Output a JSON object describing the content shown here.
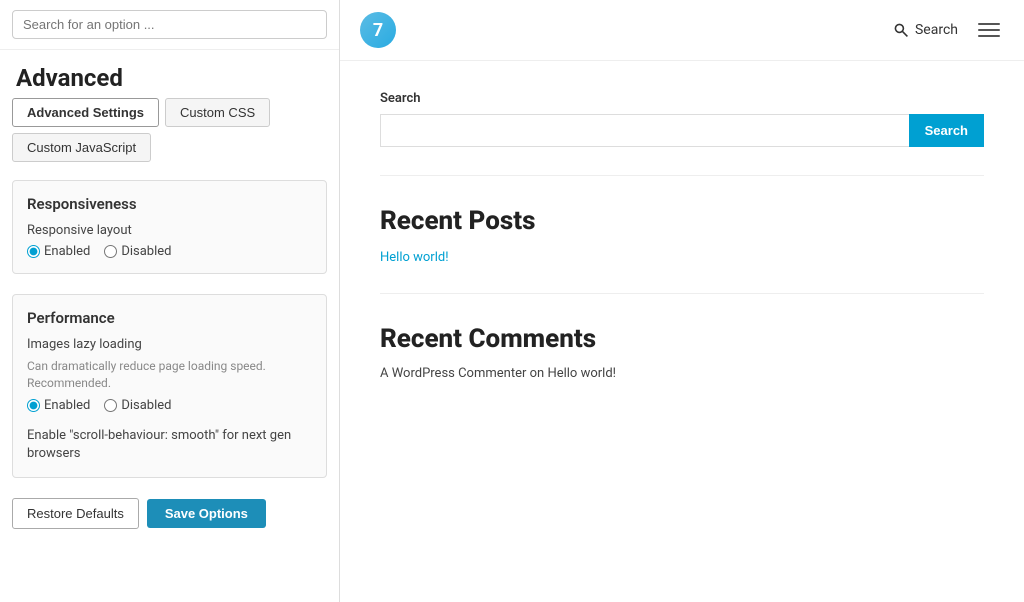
{
  "left": {
    "search_placeholder": "Search for an option ...",
    "heading": "Advanced",
    "tabs": [
      {
        "id": "advanced-settings",
        "label": "Advanced Settings",
        "active": true
      },
      {
        "id": "custom-css",
        "label": "Custom CSS",
        "active": false
      },
      {
        "id": "custom-js",
        "label": "Custom JavaScript",
        "active": false
      }
    ],
    "responsiveness": {
      "title": "Responsiveness",
      "layout_label": "Responsive layout",
      "options": [
        {
          "id": "enabled",
          "label": "Enabled",
          "checked": true
        },
        {
          "id": "disabled",
          "label": "Disabled",
          "checked": false
        }
      ]
    },
    "performance": {
      "title": "Performance",
      "lazy_loading_label": "Images lazy loading",
      "lazy_loading_desc": "Can dramatically reduce page loading speed. Recommended.",
      "options": [
        {
          "id": "perf-enabled",
          "label": "Enabled",
          "checked": true
        },
        {
          "id": "perf-disabled",
          "label": "Disabled",
          "checked": false
        }
      ],
      "scroll_behaviour_label": "Enable \"scroll-behaviour: smooth\" for next gen browsers"
    },
    "buttons": {
      "restore": "Restore Defaults",
      "save": "Save Options"
    }
  },
  "right": {
    "logo_number": "7",
    "top_search_label": "Search",
    "hamburger_label": "Menu",
    "widgets": [
      {
        "id": "search-widget",
        "type": "search",
        "title": "Search",
        "search_placeholder": "",
        "search_btn": "Search"
      },
      {
        "id": "recent-posts-widget",
        "type": "posts",
        "title": "Recent Posts",
        "items": [
          "Hello world!"
        ]
      },
      {
        "id": "recent-comments-widget",
        "type": "comments",
        "title": "Recent Comments",
        "items": [
          "A WordPress Commenter on Hello world!"
        ]
      }
    ]
  }
}
